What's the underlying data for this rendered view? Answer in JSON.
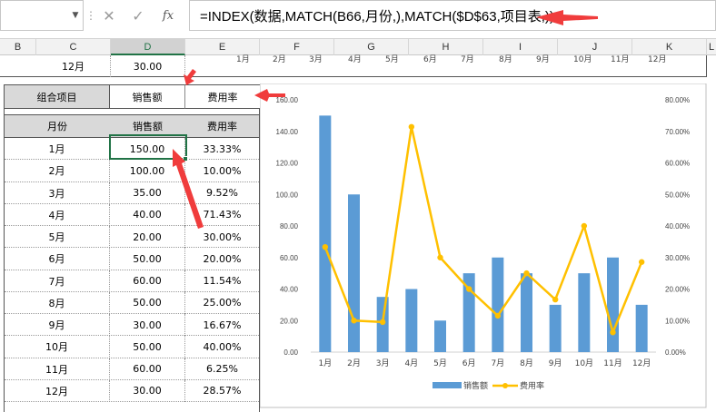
{
  "formula_bar": {
    "name_box": "",
    "cancel_icon": "✕",
    "enter_icon": "✓",
    "fx_icon": "fx",
    "formula": "=INDEX(数据,MATCH(B66,月份,),MATCH($D$63,项目表,))"
  },
  "columns": [
    "B",
    "C",
    "D",
    "E",
    "F",
    "G",
    "H",
    "I",
    "J",
    "K",
    "L"
  ],
  "top_row": {
    "month": "12月",
    "value": "30.00"
  },
  "top_axis_months": [
    "1月",
    "2月",
    "3月",
    "4月",
    "5月",
    "6月",
    "7月",
    "8月",
    "9月",
    "10月",
    "11月",
    "12月"
  ],
  "selector": {
    "label": "组合项目",
    "option1": "销售额",
    "option2": "费用率"
  },
  "table": {
    "headers": [
      "月份",
      "销售额",
      "费用率"
    ],
    "rows": [
      [
        "1月",
        "150.00",
        "33.33%"
      ],
      [
        "2月",
        "100.00",
        "10.00%"
      ],
      [
        "3月",
        "35.00",
        "9.52%"
      ],
      [
        "4月",
        "40.00",
        "71.43%"
      ],
      [
        "5月",
        "20.00",
        "30.00%"
      ],
      [
        "6月",
        "50.00",
        "20.00%"
      ],
      [
        "7月",
        "60.00",
        "11.54%"
      ],
      [
        "8月",
        "50.00",
        "25.00%"
      ],
      [
        "9月",
        "30.00",
        "16.67%"
      ],
      [
        "10月",
        "50.00",
        "40.00%"
      ],
      [
        "11月",
        "60.00",
        "6.25%"
      ],
      [
        "12月",
        "30.00",
        "28.57%"
      ]
    ]
  },
  "colors": {
    "bar": "#5b9bd5",
    "line": "#ffc000",
    "arrow": "#f03c3c",
    "selected": "#217346"
  },
  "chart_data": {
    "type": "bar",
    "categories": [
      "1月",
      "2月",
      "3月",
      "4月",
      "5月",
      "6月",
      "7月",
      "8月",
      "9月",
      "10月",
      "11月",
      "12月"
    ],
    "series": [
      {
        "name": "销售额",
        "type": "bar",
        "axis": "left",
        "values": [
          150,
          100,
          35,
          40,
          20,
          50,
          60,
          50,
          30,
          50,
          60,
          30
        ]
      },
      {
        "name": "费用率",
        "type": "line",
        "axis": "right",
        "values": [
          33.33,
          10.0,
          9.52,
          71.43,
          30.0,
          20.0,
          11.54,
          25.0,
          16.67,
          40.0,
          6.25,
          28.57
        ]
      }
    ],
    "y_left": {
      "min": 0,
      "max": 160,
      "ticks": [
        "0.00",
        "20.00",
        "40.00",
        "60.00",
        "80.00",
        "100.00",
        "120.00",
        "140.00",
        "160.00"
      ]
    },
    "y_right": {
      "min": 0,
      "max": 80,
      "ticks": [
        "0.00%",
        "10.00%",
        "20.00%",
        "30.00%",
        "40.00%",
        "50.00%",
        "60.00%",
        "70.00%",
        "80.00%"
      ]
    },
    "legend": {
      "position": "bottom",
      "items": [
        "销售额",
        "费用率"
      ]
    },
    "grid": false
  }
}
